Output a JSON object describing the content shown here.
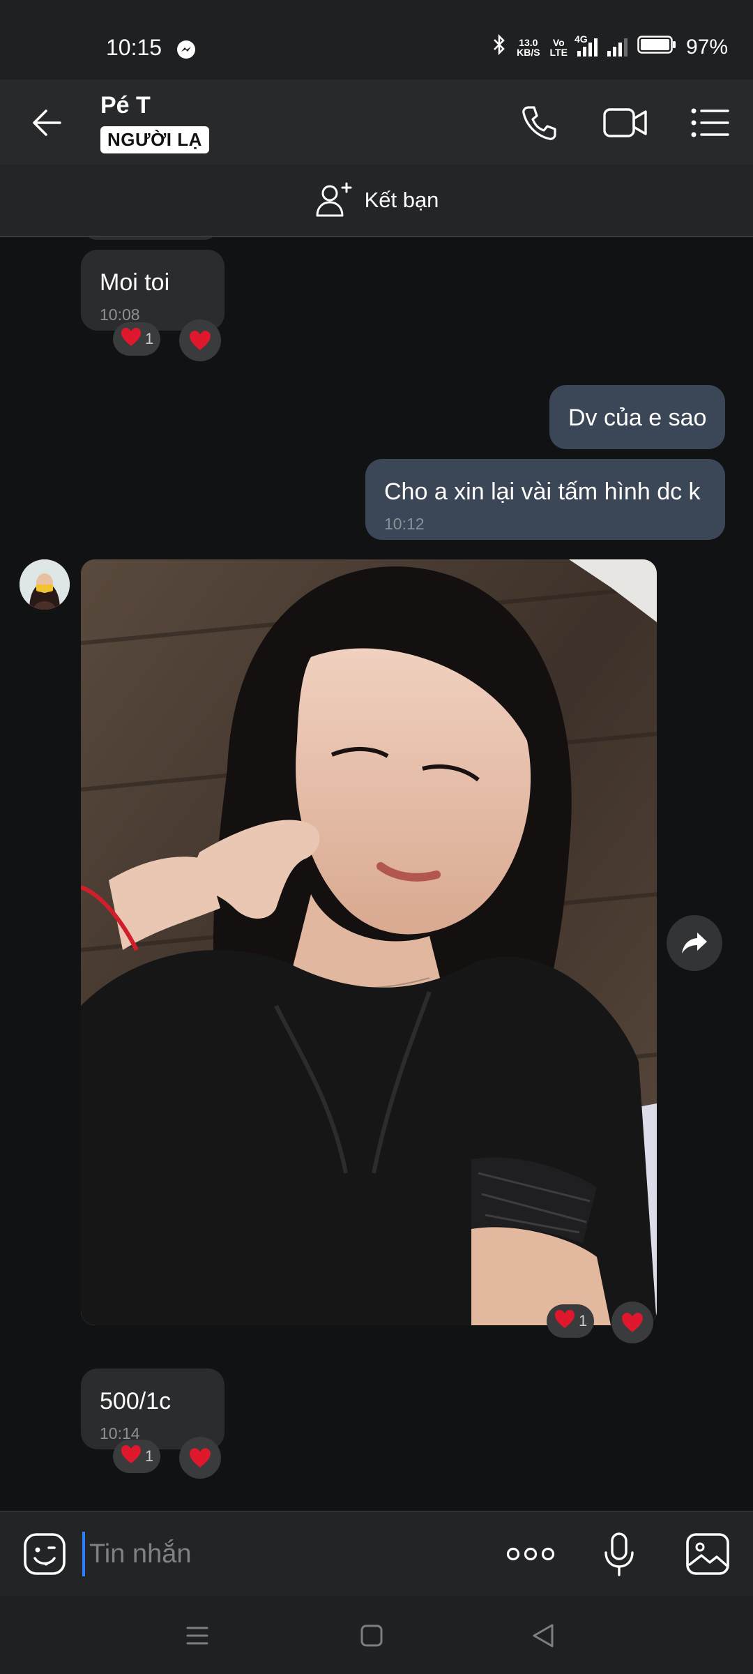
{
  "status": {
    "time": "10:15",
    "net_speed_top": "13.0",
    "net_speed_bottom": "KB/S",
    "volte_top": "Vo",
    "volte_bottom": "LTE",
    "lte_label": "4G",
    "battery": "97%"
  },
  "header": {
    "contact_name": "Pé T",
    "badge": "NGƯỜI LẠ"
  },
  "add_friend": {
    "label": "Kết bạn"
  },
  "messages": [
    {
      "text": "Moi toi",
      "time": "10:08",
      "reaction_count": "1"
    },
    {
      "text": "Dv của e sao"
    },
    {
      "text": "Cho a xin lại vài tấm hình dc k",
      "time": "10:12"
    },
    {
      "photo_reaction_count": "1"
    },
    {
      "text": "500/1c",
      "time": "10:14",
      "reaction_count": "1"
    }
  ],
  "composer": {
    "placeholder": "Tin nhắn"
  },
  "colors": {
    "accent": "#2b7fff",
    "heart": "#e0182d",
    "incoming": "#2b2c2e",
    "outgoing": "#3b4756"
  }
}
